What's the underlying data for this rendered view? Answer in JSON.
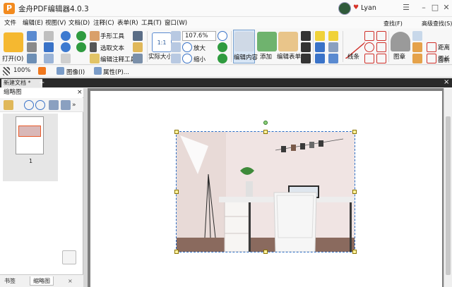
{
  "titlebar": {
    "logo_letter": "P",
    "title": "金舟PDF编辑器4.0.3",
    "user": "Lyan",
    "heart_icon": "♥"
  },
  "menu": [
    "文件",
    "编辑(E)",
    "视图(V)",
    "文档(D)",
    "注释(C)",
    "表单(R)",
    "工具(T)",
    "窗口(W)"
  ],
  "ribbon": {
    "open_label": "打开(O)",
    "hand_tool": "手形工具",
    "select_text": "选取文本",
    "edit_annot_tool": "编辑注释工具",
    "actual_size": "实际大小",
    "zoom_value": "107.6%",
    "zoom_in": "放大",
    "zoom_out": "缩小",
    "edit_content": "编辑内容",
    "add": "添加",
    "edit_form": "编辑表单",
    "lines": "线条",
    "stamp": "图章",
    "find": "查找(F)",
    "advanced_find": "高级查找(S)",
    "distance": "距离",
    "perimeter": "周长",
    "area": "面积"
  },
  "formatbar": {
    "zoom_value": "100%",
    "image_label": "图像(I)",
    "properties_label": "属性(P)..."
  },
  "doc_tab": {
    "label": "新建文档 *",
    "close": "×",
    "add": "+",
    "close_all": "×"
  },
  "left_panel": {
    "title": "缩略图",
    "close": "×",
    "page_number": "1"
  },
  "bottom_tabs": {
    "bookmarks": "书签",
    "thumbnails": "缩略图"
  },
  "colors": {
    "accent": "#2a6cc4",
    "logo": "#f28a1e",
    "selection": "#d8e6f6"
  }
}
